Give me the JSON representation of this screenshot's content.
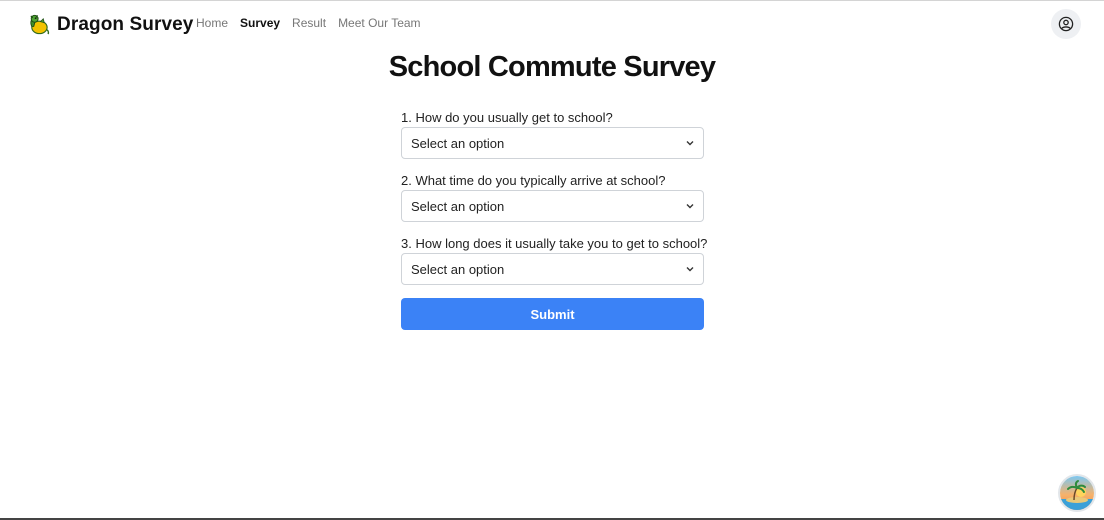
{
  "header": {
    "brand": "Dragon Survey",
    "logo_icon": "dragon-icon",
    "nav": [
      {
        "label": "Home",
        "active": false
      },
      {
        "label": "Survey",
        "active": true
      },
      {
        "label": "Result",
        "active": false
      },
      {
        "label": "Meet Our Team",
        "active": false
      }
    ],
    "user_icon": "user-circle-icon"
  },
  "main": {
    "title": "School Commute Survey",
    "questions": [
      {
        "label": "1. How do you usually get to school?",
        "value": "Select an option"
      },
      {
        "label": "2. What time do you typically arrive at school?",
        "value": "Select an option"
      },
      {
        "label": "3. How long does it usually take you to get to school?",
        "value": "Select an option"
      }
    ],
    "submit_label": "Submit"
  },
  "widget": {
    "icon": "island-icon"
  },
  "colors": {
    "accent": "#3b82f6",
    "text": "#111111",
    "nav_inactive": "#777777"
  }
}
